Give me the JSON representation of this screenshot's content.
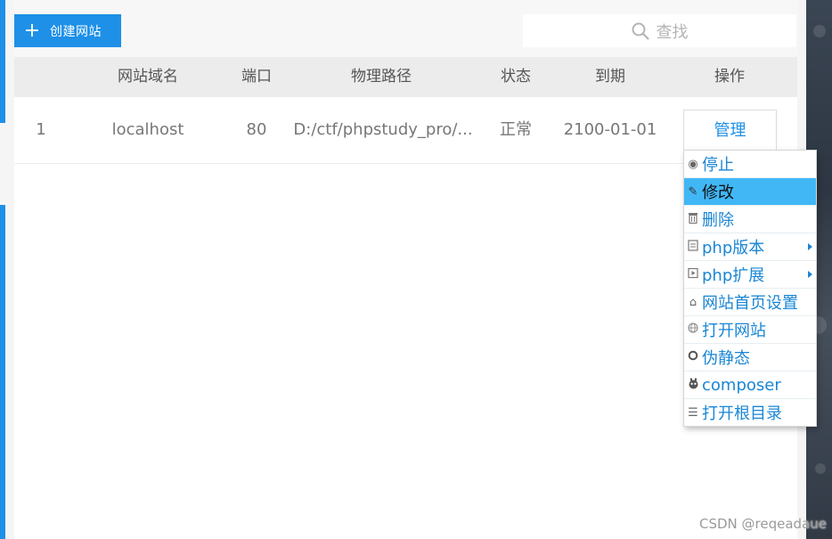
{
  "toolbar": {
    "create_label": "创建网站",
    "search_placeholder": "查找"
  },
  "table": {
    "columns": [
      "网站域名",
      "端口",
      "物理路径",
      "状态",
      "到期",
      "操作"
    ],
    "row": {
      "index": "1",
      "domain": "localhost",
      "port": "80",
      "path": "D:/ctf/phpstudy_pro/...",
      "status": "正常",
      "expire": "2100-01-01",
      "action": "管理"
    }
  },
  "menu": {
    "items": [
      {
        "label": "停止",
        "icon": "stop-icon"
      },
      {
        "label": "修改",
        "icon": "edit-icon"
      },
      {
        "label": "删除",
        "icon": "trash-icon"
      },
      {
        "label": "php版本",
        "icon": "php-version-icon"
      },
      {
        "label": "php扩展",
        "icon": "php-extension-icon"
      },
      {
        "label": "网站首页设置",
        "icon": "home-icon"
      },
      {
        "label": "打开网站",
        "icon": "globe-icon"
      },
      {
        "label": "伪静态",
        "icon": "rewrite-icon"
      },
      {
        "label": "composer",
        "icon": "composer-icon"
      },
      {
        "label": "打开根目录",
        "icon": "list-icon"
      }
    ],
    "active_item": "修改"
  },
  "watermark": "CSDN @reqeadaue",
  "colors": {
    "accent": "#1e90e8",
    "menu_active": "#41b7f6",
    "menu_text": "#1a86d4"
  }
}
